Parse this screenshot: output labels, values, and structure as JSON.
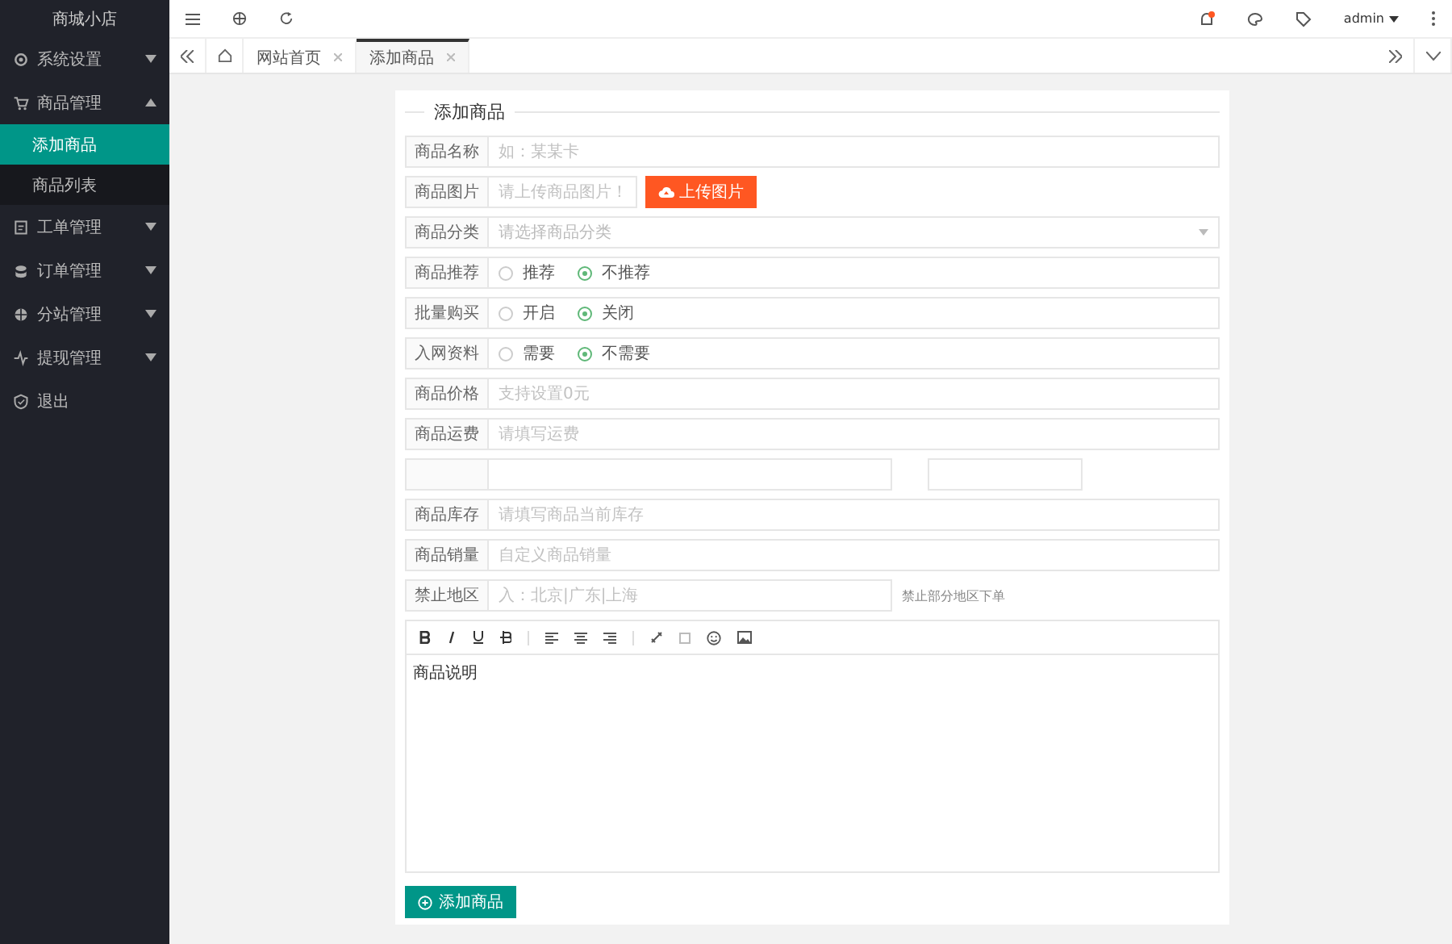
{
  "sidebar": {
    "brand": "商城小店",
    "items": [
      {
        "label": "系统设置",
        "expanded": false
      },
      {
        "label": "商品管理",
        "expanded": true,
        "children": [
          {
            "label": "添加商品",
            "selected": true
          },
          {
            "label": "商品列表",
            "selected": false
          }
        ]
      },
      {
        "label": "工单管理",
        "expanded": false
      },
      {
        "label": "订单管理",
        "expanded": false
      },
      {
        "label": "分站管理",
        "expanded": false
      },
      {
        "label": "提现管理",
        "expanded": false
      },
      {
        "label": "退出"
      }
    ]
  },
  "header": {
    "user": "admin"
  },
  "tabs": [
    {
      "label": "网站首页",
      "selected": false
    },
    {
      "label": "添加商品",
      "selected": true
    }
  ],
  "form": {
    "title": "添加商品",
    "rows": [
      {
        "kind": "text",
        "label": "商品名称",
        "placeholder": "如：某某卡"
      },
      {
        "kind": "upload",
        "label": "商品图片",
        "placeholder": "请上传商品图片！",
        "button": "上传图片"
      },
      {
        "kind": "select",
        "label": "商品分类",
        "placeholder": "请选择商品分类"
      },
      {
        "kind": "radio",
        "label": "商品推荐",
        "options": [
          {
            "label": "推荐",
            "selected": false
          },
          {
            "label": "不推荐",
            "selected": true
          }
        ]
      },
      {
        "kind": "radio",
        "label": "批量购买",
        "options": [
          {
            "label": "开启",
            "selected": false
          },
          {
            "label": "关闭",
            "selected": true
          }
        ]
      },
      {
        "kind": "radio",
        "label": "入网资料",
        "options": [
          {
            "label": "需要",
            "selected": false
          },
          {
            "label": "不需要",
            "selected": true
          }
        ]
      },
      {
        "kind": "text",
        "label": "商品价格",
        "placeholder": "支持设置0元"
      },
      {
        "kind": "text",
        "label": "商品运费",
        "placeholder": "请填写运费"
      },
      {
        "kind": "pair"
      },
      {
        "kind": "text",
        "label": "商品库存",
        "placeholder": "请填写商品当前库存"
      },
      {
        "kind": "text",
        "label": "商品销量",
        "placeholder": "自定义商品销量"
      },
      {
        "kind": "hint",
        "label": "禁止地区",
        "placeholder": "入：北京|广东|上海",
        "hint": "禁止部分地区下单"
      }
    ],
    "editor": {
      "content": "商品说明"
    },
    "submit": "添加商品"
  }
}
